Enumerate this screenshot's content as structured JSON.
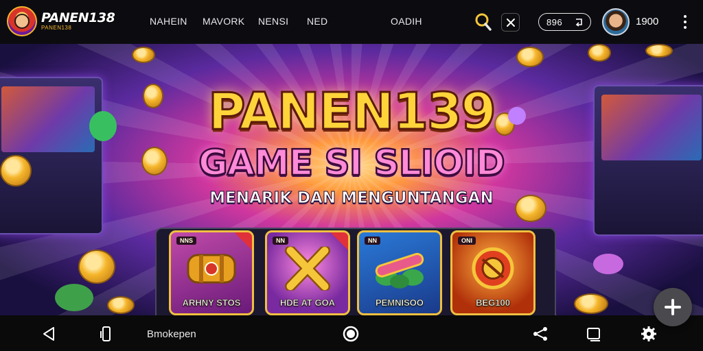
{
  "header": {
    "logo_title": "PANEN138",
    "logo_subtitle": "PANEN138",
    "nav": [
      "NAHEIN",
      "MAVORK",
      "NENSI",
      "NED",
      "OADIH"
    ],
    "balance_value": "896",
    "balance_icon": "refresh-icon",
    "points": "1900",
    "search_icon": "search-icon",
    "tools_icon": "close-icon"
  },
  "banner": {
    "headline": "PANEN139",
    "subheadline": "GAME SI SLIOID",
    "tagline": "MENARIK DAN MENGUNTANGAN",
    "cards": [
      {
        "tag": "NNS",
        "name": "ARHNY STOS",
        "color": "#a0309a"
      },
      {
        "tag": "NN",
        "name": "HDE AT GOA",
        "color": "#7a2aa0"
      },
      {
        "tag": "NN",
        "name": "PEMNISOO",
        "color": "#1f5fae"
      },
      {
        "tag": "ONI",
        "name": "BEG100",
        "color": "#c0481c"
      }
    ],
    "fab_icon": "plus-icon"
  },
  "bottom_nav": {
    "label": "Bmokepen",
    "icons": [
      "back-icon",
      "rotate-icon",
      "home-icon",
      "share-icon",
      "window-icon",
      "settings-icon"
    ]
  }
}
